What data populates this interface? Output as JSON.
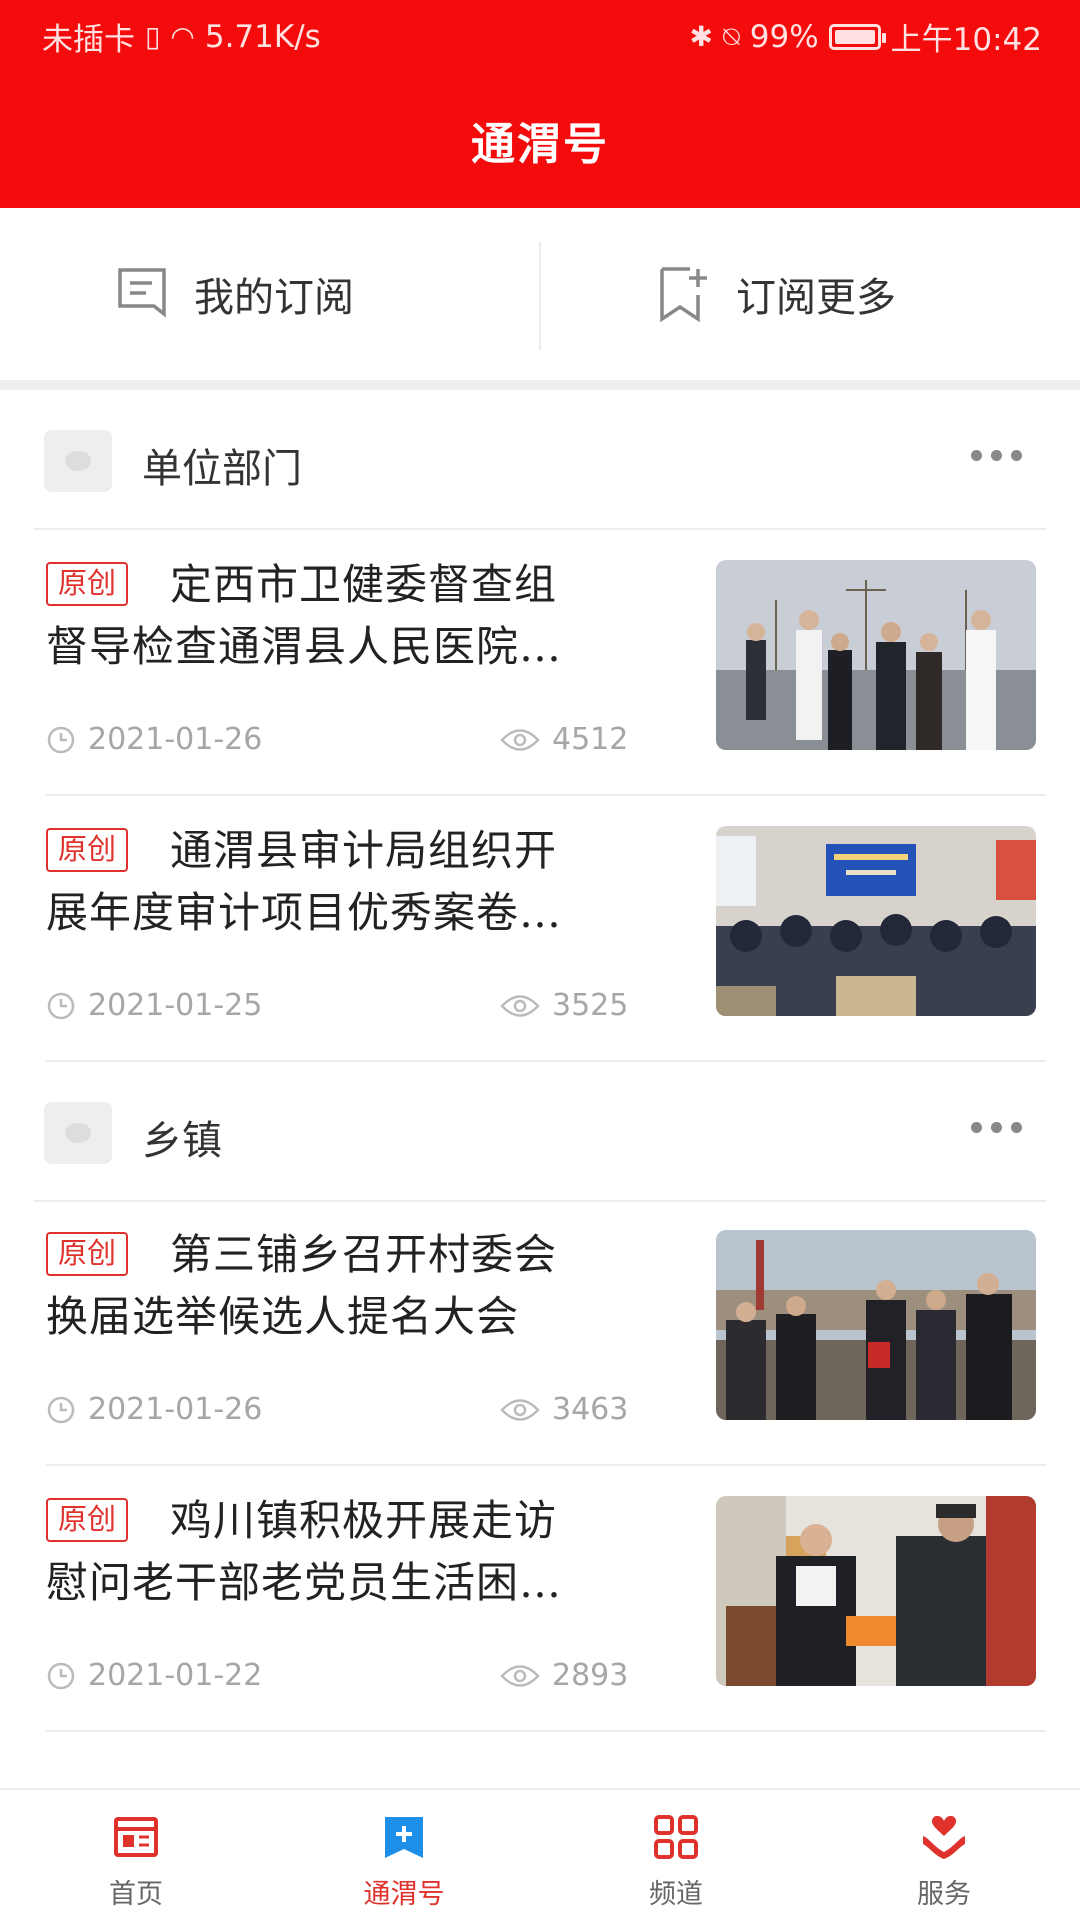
{
  "status_bar": {
    "carrier": "未插卡",
    "speed": "5.71K/s",
    "battery": "99%",
    "time": "上午10:42"
  },
  "header": {
    "title": "通渭号"
  },
  "subscription": {
    "my_label": "我的订阅",
    "more_label": "订阅更多"
  },
  "sections": [
    {
      "name": "单位部门",
      "articles": [
        {
          "badge": "原创",
          "title_line1": "定西市卫健委督查组",
          "title_line2": "督导检查通渭县人民医院…",
          "date": "2021-01-26",
          "views": "4512"
        },
        {
          "badge": "原创",
          "title_line1": "通渭县审计局组织开",
          "title_line2": "展年度审计项目优秀案卷…",
          "date": "2021-01-25",
          "views": "3525"
        }
      ]
    },
    {
      "name": "乡镇",
      "articles": [
        {
          "badge": "原创",
          "title_line1": "第三铺乡召开村委会",
          "title_line2": "换届选举候选人提名大会",
          "date": "2021-01-26",
          "views": "3463"
        },
        {
          "badge": "原创",
          "title_line1": "鸡川镇积极开展走访",
          "title_line2": "慰问老干部老党员生活困…",
          "date": "2021-01-22",
          "views": "2893"
        }
      ]
    }
  ],
  "bottom_nav": [
    {
      "label": "首页",
      "icon": "newspaper-icon"
    },
    {
      "label": "通渭号",
      "icon": "bookmark-plus-icon",
      "active": true
    },
    {
      "label": "频道",
      "icon": "grid-icon"
    },
    {
      "label": "服务",
      "icon": "heart-hands-icon"
    }
  ],
  "colors": {
    "brand_red": "#f40b0b",
    "badge_red": "#e0322c",
    "active_blue": "#1e8fe8"
  }
}
